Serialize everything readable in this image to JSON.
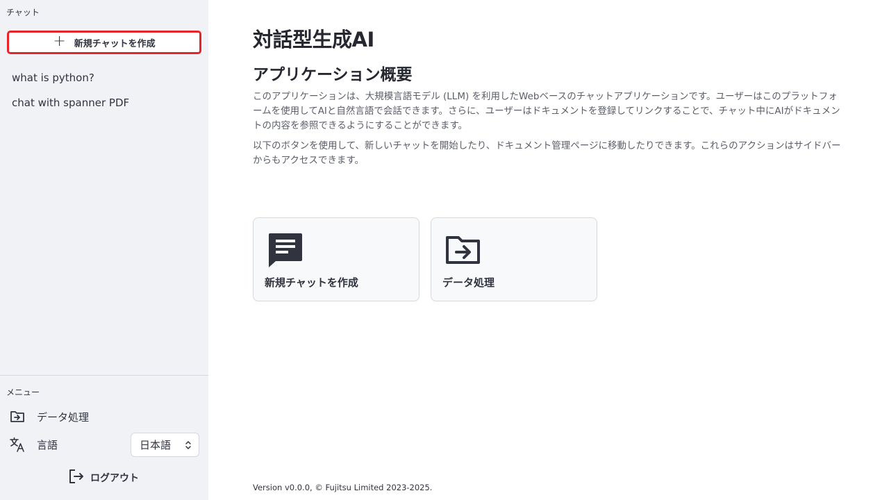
{
  "sidebar": {
    "chat_section_label": "チャット",
    "new_chat_button": "新規チャットを作成",
    "history": [
      "what is python?",
      "chat with spanner PDF"
    ],
    "menu_label": "メニュー",
    "menu_data_processing": "データ処理",
    "menu_language": "言語",
    "language_selected": "日本語",
    "logout": "ログアウト"
  },
  "main": {
    "title": "対話型生成AI",
    "section_title": "アプリケーション概要",
    "paragraph1": "このアプリケーションは、大規模言語モデル (LLM) を利用したWebベースのチャットアプリケーションです。ユーザーはこのプラットフォームを使用してAIと自然言語で会話できます。さらに、ユーザーはドキュメントを登録してリンクすることで、チャット中にAIがドキュメントの内容を参照できるようにすることができます。",
    "paragraph2": "以下のボタンを使用して、新しいチャットを開始したり、ドキュメント管理ページに移動したりできます。これらのアクションはサイドバーからもアクセスできます。",
    "cards": [
      {
        "label": "新規チャットを作成",
        "icon": "chat-icon"
      },
      {
        "label": "データ処理",
        "icon": "folder-arrow-icon"
      }
    ],
    "footer": "Version v0.0.0, © Fujitsu Limited 2023-2025."
  },
  "colors": {
    "sidebar_bg": "#f0f2f6",
    "highlight_border": "#e8232a",
    "text": "#31333f"
  }
}
